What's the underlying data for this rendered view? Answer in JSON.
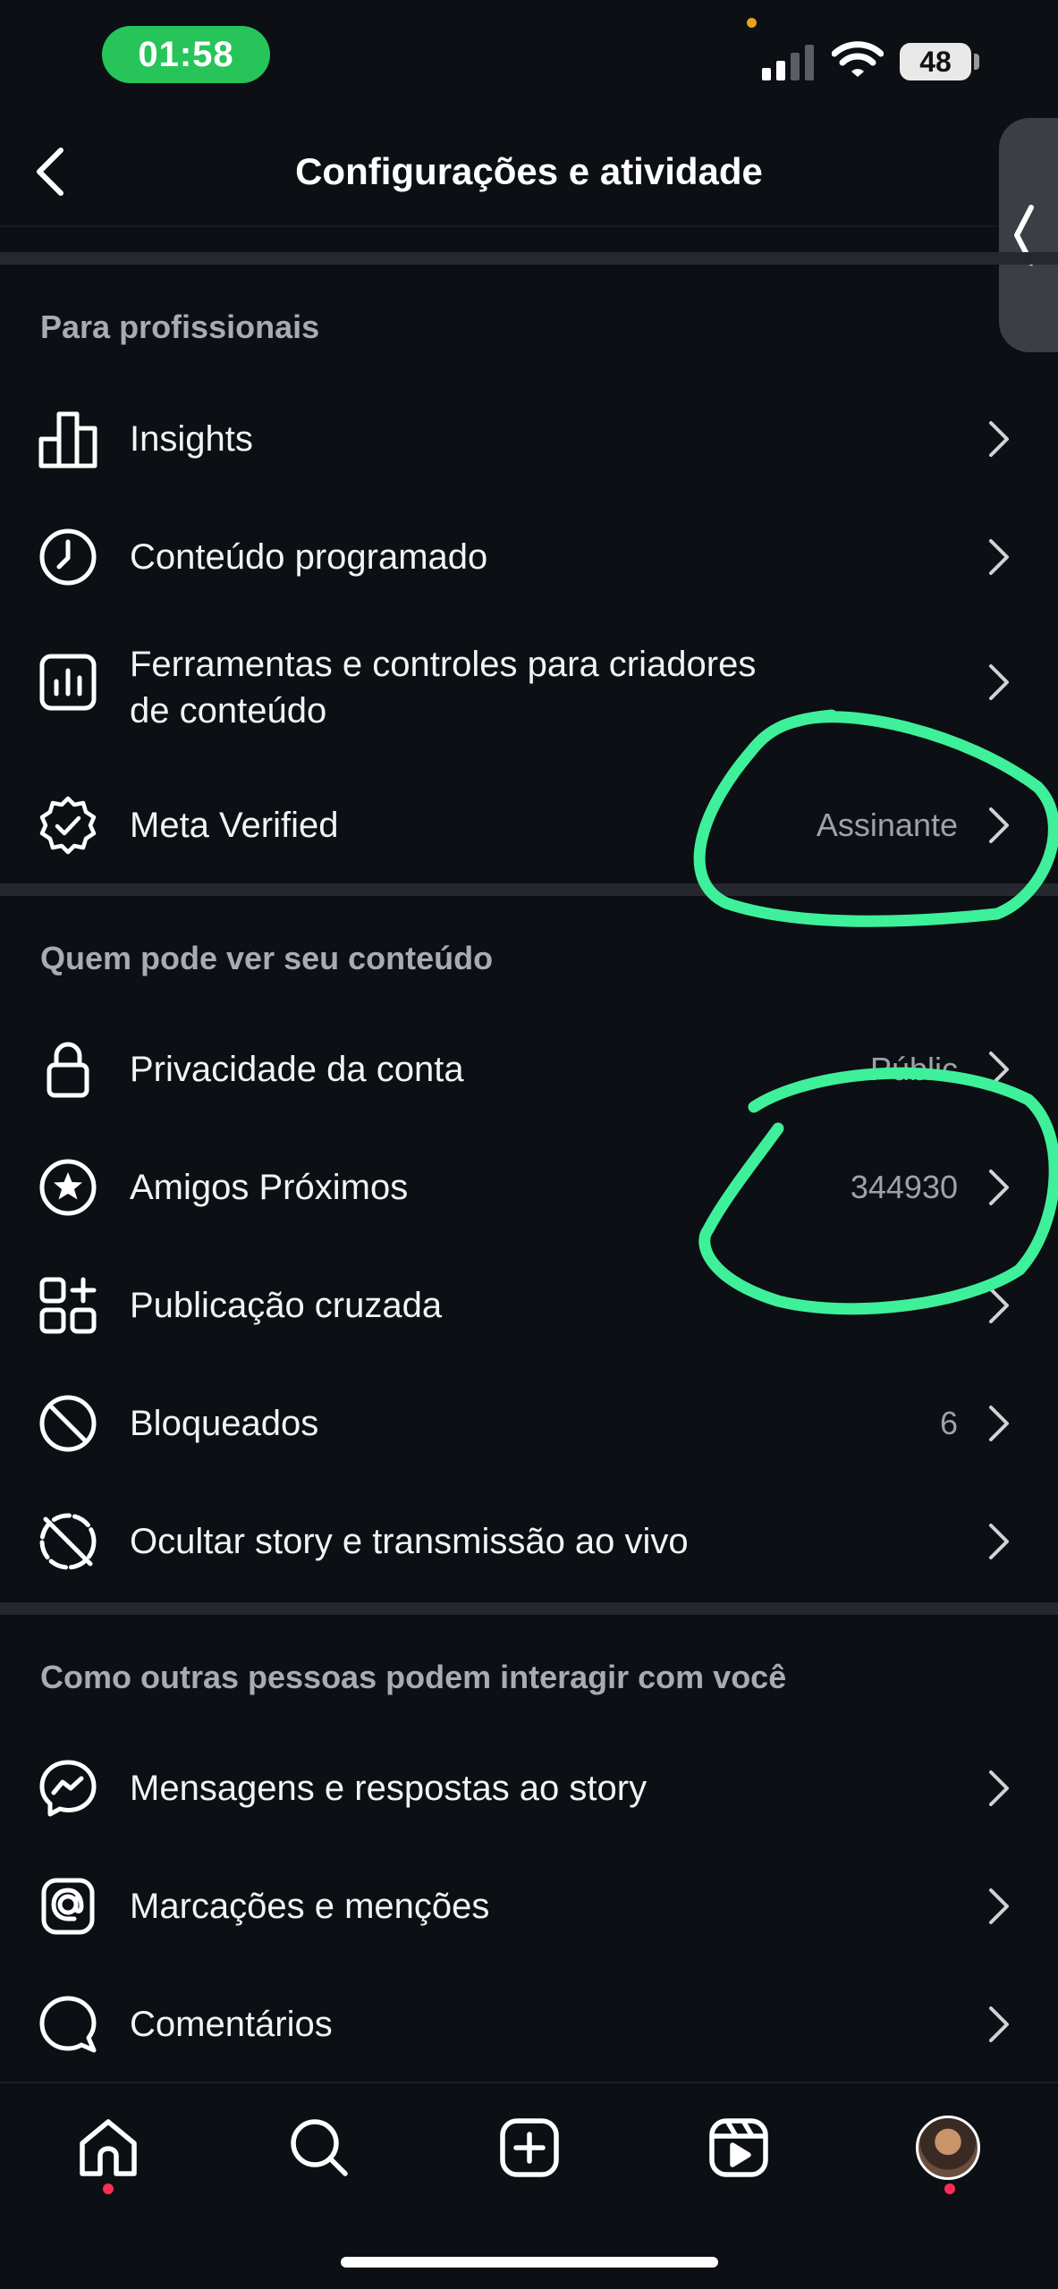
{
  "status_bar": {
    "time": "01:58",
    "battery": "48"
  },
  "header": {
    "title": "Configurações e atividade"
  },
  "sections": [
    {
      "title": "Para profissionais",
      "items": [
        {
          "label": "Insights",
          "value": "",
          "icon": "bar-chart-icon"
        },
        {
          "label": "Conteúdo programado",
          "value": "",
          "icon": "clock-icon"
        },
        {
          "label": "Ferramentas e controles para criadores",
          "label_line2": "de conteúdo",
          "value": "",
          "icon": "dashboard-icon"
        },
        {
          "label": "Meta Verified",
          "value": "Assinante",
          "icon": "verified-badge-icon"
        }
      ]
    },
    {
      "title": "Quem pode ver seu conteúdo",
      "items": [
        {
          "label": "Privacidade da conta",
          "value": "Públic",
          "icon": "lock-icon"
        },
        {
          "label": "Amigos Próximos",
          "value": "344930",
          "icon": "star-circle-icon"
        },
        {
          "label": "Publicação cruzada",
          "value": "",
          "icon": "grid-plus-icon"
        },
        {
          "label": "Bloqueados",
          "value": "6",
          "icon": "blocked-icon"
        },
        {
          "label": "Ocultar story e transmissão ao vivo",
          "value": "",
          "icon": "hide-story-icon"
        }
      ]
    },
    {
      "title": "Como outras pessoas podem interagir com você",
      "items": [
        {
          "label": "Mensagens e respostas ao story",
          "value": "",
          "icon": "messenger-icon"
        },
        {
          "label": "Marcações e menções",
          "value": "",
          "icon": "at-sign-icon"
        },
        {
          "label": "Comentários",
          "value": "",
          "icon": "comment-icon"
        }
      ]
    }
  ],
  "nav": [
    "home-icon",
    "search-icon",
    "create-icon",
    "reels-icon",
    "profile-avatar"
  ],
  "colors": {
    "background": "#0c0f14",
    "annotation": "#3ef09a",
    "clock_pill": "#27c45a"
  }
}
